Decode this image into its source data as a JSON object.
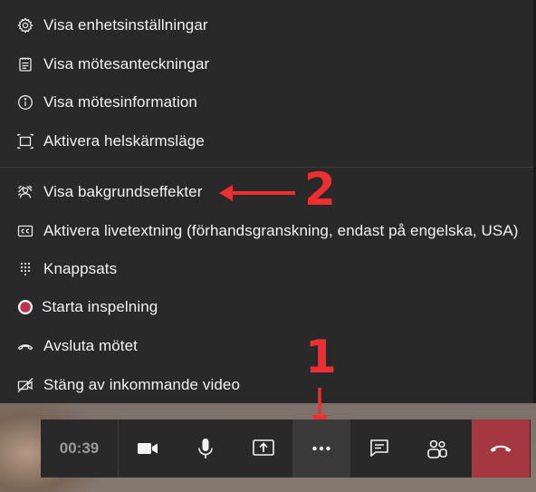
{
  "menu": {
    "items": [
      {
        "label": "Visa enhetsinställningar",
        "icon": "gear-icon"
      },
      {
        "label": "Visa mötesanteckningar",
        "icon": "notes-icon"
      },
      {
        "label": "Visa mötesinformation",
        "icon": "info-icon"
      },
      {
        "label": "Aktivera helskärmsläge",
        "icon": "fullscreen-icon"
      },
      {
        "label": "Visa bakgrundseffekter",
        "icon": "background-effects-icon"
      },
      {
        "label": "Aktivera livetextning (förhandsgranskning, endast på engelska, USA)",
        "icon": "closed-captions-icon"
      },
      {
        "label": "Knappsats",
        "icon": "dialpad-icon"
      },
      {
        "label": "Starta inspelning",
        "icon": "record-icon"
      },
      {
        "label": "Avsluta mötet",
        "icon": "hangup-icon"
      },
      {
        "label": "Stäng av inkommande video",
        "icon": "video-off-icon"
      }
    ]
  },
  "annotations": {
    "step1": "1",
    "step2": "2",
    "color": "#ef2f2f"
  },
  "toolbar": {
    "timer": "00:39",
    "buttons": [
      "camera-icon",
      "microphone-icon",
      "share-screen-icon",
      "more-options-icon",
      "chat-icon",
      "participants-icon",
      "hangup-icon"
    ],
    "end_color": "#a4373f"
  }
}
